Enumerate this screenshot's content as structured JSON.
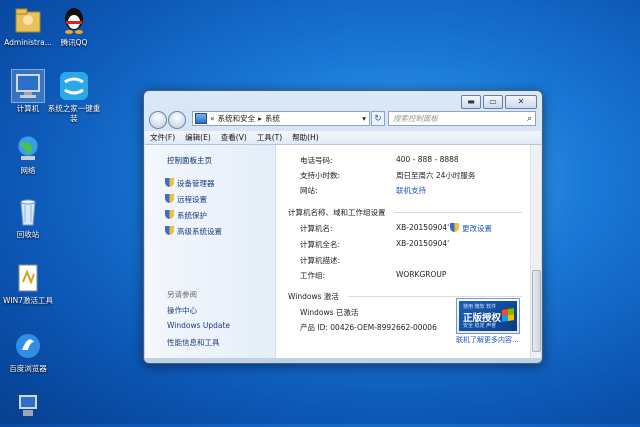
{
  "desktop": {
    "icons": [
      {
        "label": "Administra..."
      },
      {
        "label": "腾讯QQ"
      },
      {
        "label": "计算机"
      },
      {
        "label": "系统之家一键重装"
      },
      {
        "label": "网络"
      },
      {
        "label": "回收站"
      },
      {
        "label": "WIN7激活工具"
      },
      {
        "label": "百度浏览器"
      },
      {
        "label": ""
      }
    ]
  },
  "window": {
    "address": {
      "prefix": "«",
      "part1": "系统和安全",
      "part2": "系统"
    },
    "search_placeholder": "搜索控制面板",
    "menu": [
      "文件(F)",
      "编辑(E)",
      "查看(V)",
      "工具(T)",
      "帮助(H)"
    ],
    "left_pane": {
      "home": "控制面板主页",
      "tasks": [
        "设备管理器",
        "远程设置",
        "系统保护",
        "高级系统设置"
      ],
      "see_also": "另请参阅",
      "links": [
        "操作中心",
        "Windows Update",
        "性能信息和工具"
      ]
    },
    "support": {
      "phone_label": "电话号码:",
      "phone_value": "400 - 888 - 8888",
      "hours_label": "支持小时数:",
      "hours_value": "周日至周六  24小时服务",
      "site_label": "网站:",
      "site_value": "联机支持"
    },
    "computer": {
      "section": "计算机名称、域和工作组设置",
      "name_label": "计算机名:",
      "name_value": "XB-20150904'",
      "change": "更改设置",
      "fullname_label": "计算机全名:",
      "fullname_value": "XB-20150904'",
      "desc_label": "计算机描述:",
      "desc_value": "",
      "group_label": "工作组:",
      "group_value": "WORKGROUP"
    },
    "activation": {
      "section": "Windows 激活",
      "status": "Windows 已激活",
      "product_id": "产品 ID: 00426-OEM-8992662-00006",
      "more_link": "联机了解更多内容...",
      "badge_top": "使用 微软 软件",
      "badge_main": "正版授权",
      "badge_bottom": "安全 稳定 声誉"
    },
    "title_buttons": {
      "min": "▬",
      "max": "▭",
      "close": "✕"
    }
  }
}
